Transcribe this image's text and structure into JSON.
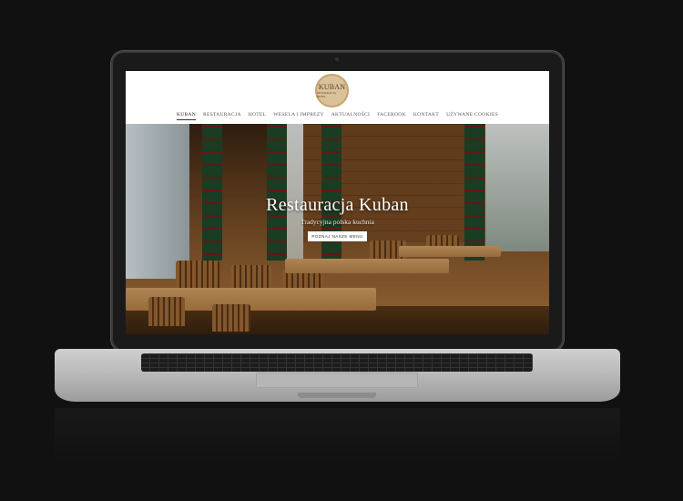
{
  "site": {
    "logo": {
      "name": "KUBAN",
      "tagline": "RESTAURACJA · HOTEL"
    },
    "nav": [
      {
        "label": "KUBAN",
        "active": true
      },
      {
        "label": "RESTAURACJA"
      },
      {
        "label": "HOTEL"
      },
      {
        "label": "WESELA I IMPREZY"
      },
      {
        "label": "AKTUALNOŚCI"
      },
      {
        "label": "FACEBOOK"
      },
      {
        "label": "KONTAKT"
      },
      {
        "label": "UŻYWANE COOKIES"
      }
    ],
    "hero": {
      "title": "Restauracja Kuban",
      "subtitle": "Tradycyjna polska kuchnia",
      "button": "POZNAJ NASZE MENU"
    }
  },
  "colors": {
    "background": "#111111",
    "logo_bg": "#d9c29a",
    "wood": "#8a5a2d",
    "curtain_green": "#1f4a2a",
    "curtain_red": "#7a1c1c"
  }
}
